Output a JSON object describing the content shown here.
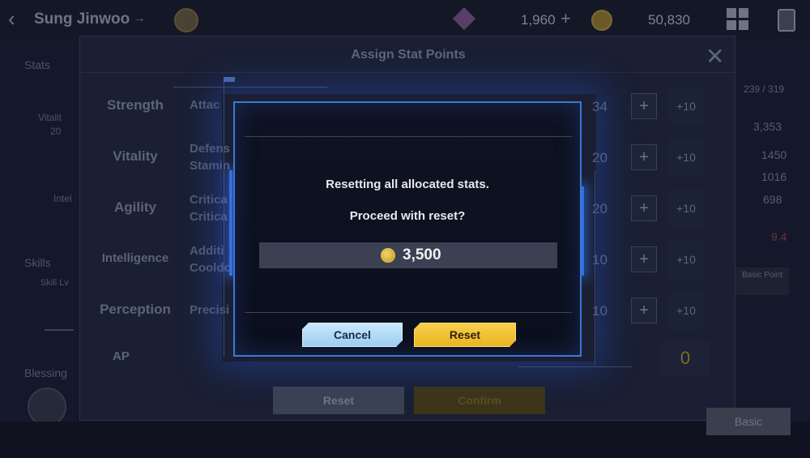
{
  "topbar": {
    "player_name": "Sung Jinwoo",
    "gem_value": "1,960",
    "gold_value": "50,830"
  },
  "background": {
    "left_labels": {
      "stats": "Stats",
      "vitality": "Vitalit",
      "vitality_val": "20",
      "intel": "Intel",
      "skills": "Skills",
      "skills_sub": "Skill Lv",
      "blessing": "Blessing"
    },
    "right_values": {
      "top": "239 / 319",
      "v1": "3,353",
      "v2": "1450",
      "v3": "1016",
      "v4": "698",
      "v5": "9.4",
      "chip": "Basic Point"
    },
    "basic_button": "Basic"
  },
  "assign_modal": {
    "title": "Assign Stat Points",
    "stats": [
      {
        "name": "Strength",
        "desc1": "Attac",
        "desc2": "",
        "value": "34"
      },
      {
        "name": "Vitality",
        "desc1": "Defens",
        "desc2": "Stamin",
        "value": "20"
      },
      {
        "name": "Agility",
        "desc1": "Critica",
        "desc2": "Critica",
        "value": "20"
      },
      {
        "name": "Intelligence",
        "desc1": "Additi",
        "desc2": "Cooldo",
        "value": "10"
      },
      {
        "name": "Perception",
        "desc1": "Precisi",
        "desc2": "",
        "value": "10"
      }
    ],
    "plus_label": "+",
    "plus10_label": "+10",
    "ap_label": "AP",
    "ap_value": "0",
    "reset_label": "Reset",
    "confirm_label": "Confirm"
  },
  "dialog": {
    "message_line1": "Resetting all allocated stats.",
    "message_line2": "Proceed with reset?",
    "cost": "3,500",
    "cancel_label": "Cancel",
    "reset_label": "Reset"
  },
  "colors": {
    "dialog_border": "#3c78d8",
    "reset_button": "#f2c536",
    "cancel_button": "#b6dcf7"
  }
}
